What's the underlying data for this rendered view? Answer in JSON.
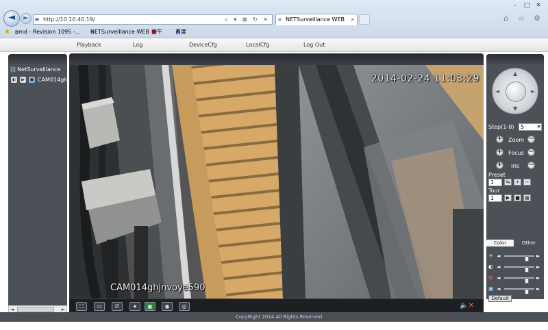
{
  "browser": {
    "url": "http://10.10.40.19/",
    "tab_title": "NETSurveillance WEB",
    "back_glyph": "◄",
    "forward_glyph": "►",
    "address_tools": "⌕ ▾ ⊠ ↻ ✕",
    "tab_close": "×",
    "window_controls": {
      "minimize": "–",
      "maximize": "□",
      "close": "✕"
    },
    "right_icons": "⌂ ☆ ⚙",
    "favorites": [
      {
        "label": "pmd - Revision 1095 -..."
      },
      {
        "label": "NETSurveillance WEB"
      },
      {
        "label": "中午"
      },
      {
        "label": "百度"
      }
    ]
  },
  "menu": {
    "items": [
      "Playback",
      "Log",
      "DeviceCfg",
      "LocalCfg",
      "Log Out"
    ]
  },
  "sidebar": {
    "root_label": "NetSurveillance",
    "camera_label": "CAM014ghj"
  },
  "video": {
    "timestamp": "2014-02-24 11:03:29",
    "camera_name": "CAM014ghjnvoye590",
    "toolbar_glyphs": [
      "⛶",
      "▭",
      "⎚",
      "⏺",
      "▣",
      "◉",
      "◎"
    ]
  },
  "ptz": {
    "step_label": "Step(1-8)",
    "step_value": "5",
    "zoom_label": "Zoom",
    "focus_label": "Focus",
    "iris_label": "Iris",
    "preset_label": "Preset",
    "preset_value": "1",
    "tour_label": "Tour",
    "tour_value": "1",
    "color_tab_label": "Color",
    "other_tab_label": "Other",
    "default_label": "Default",
    "color_sliders": [
      {
        "icon": "brightness-icon",
        "level": 0.75
      },
      {
        "icon": "contrast-icon",
        "level": 0.75
      },
      {
        "icon": "saturation-icon",
        "level": 0.75
      },
      {
        "icon": "hue-icon",
        "level": 0.75
      }
    ]
  },
  "footer": {
    "copyright": "CopyRight 2014 All Rights Reserved"
  },
  "colors": {
    "panel": "#4c5158",
    "panel_dark": "#2c2f33",
    "menubar": "#e4e4e4",
    "chrome": "#cdd9e8"
  }
}
